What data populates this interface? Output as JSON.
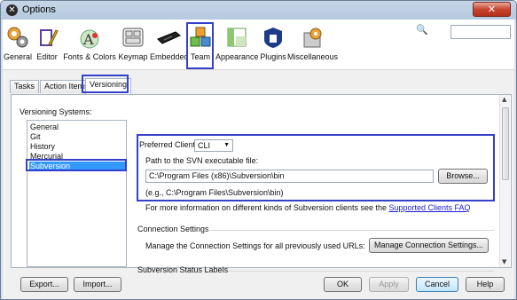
{
  "window": {
    "title": "Options",
    "close_label": "✕"
  },
  "toolbar": {
    "items": [
      {
        "label": "General",
        "icon": "gear-icon"
      },
      {
        "label": "Editor",
        "icon": "editor-icon"
      },
      {
        "label": "Fonts & Colors",
        "icon": "fonts-colors-icon"
      },
      {
        "label": "Keymap",
        "icon": "keyboard-icon"
      },
      {
        "label": "Embedded",
        "icon": "chip-icon"
      },
      {
        "label": "Team",
        "icon": "team-cubes-icon"
      },
      {
        "label": "Appearance",
        "icon": "appearance-icon"
      },
      {
        "label": "Plugins",
        "icon": "plugin-icon"
      },
      {
        "label": "Miscellaneous",
        "icon": "misc-icon"
      }
    ],
    "selected": "Team",
    "search_icon": "🔍",
    "search_value": ""
  },
  "tabs": {
    "items": [
      "Tasks",
      "Action Items",
      "Versioning"
    ],
    "active": "Versioning"
  },
  "versioning": {
    "systems_label": "Versioning Systems:",
    "systems": [
      "General",
      "Git",
      "History",
      "Mercurial",
      "Subversion"
    ],
    "selected": "Subversion"
  },
  "subversion": {
    "preferred_client_label": "Preferred Client:",
    "preferred_client_value": "CLI",
    "path_label": "Path to the SVN executable file:",
    "path_value": "C:\\Program Files (x86)\\Subversion\\bin",
    "browse_label": "Browse...",
    "example_text": "(e.g., C:\\Program Files\\Subversion\\bin)",
    "more_info_text": "For more information on different kinds of Subversion clients see the",
    "faq_link": "Supported Clients FAQ",
    "connection_settings_heading": "Connection Settings",
    "connection_settings_text": "Manage the Connection Settings for all previously used URLs:",
    "manage_button": "Manage Connection Settings...",
    "status_labels_heading": "Subversion Status Labels"
  },
  "buttons": {
    "export": "Export...",
    "import": "Import...",
    "ok": "OK",
    "apply": "Apply",
    "cancel": "Cancel",
    "help": "Help"
  },
  "colors": {
    "highlight": "#3440c9",
    "selection": "#3399ff",
    "link": "#1a1ad0"
  }
}
